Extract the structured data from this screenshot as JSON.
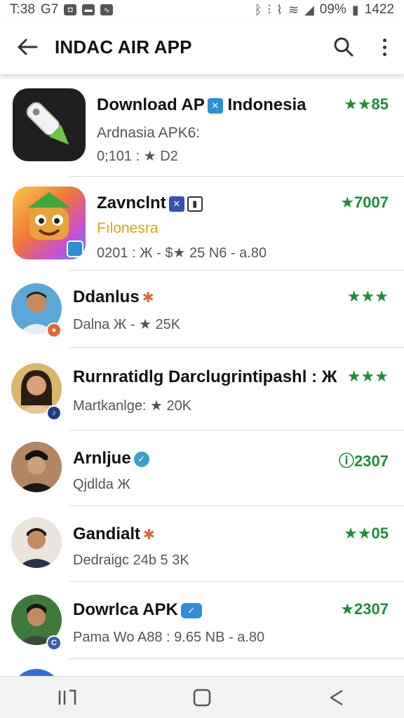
{
  "status_bar": {
    "time": "T:38",
    "carrier": "G7",
    "battery": "09%",
    "clock": "1422"
  },
  "app_bar": {
    "title": "INDAC AIR APP"
  },
  "apps": [
    {
      "name": "Download AP",
      "name_suffix": "Indonesia",
      "sub": "Ardnasia APK6:",
      "meta": "0;101 : ★ D2",
      "rating": "★★85"
    },
    {
      "name": "Zavnclnt",
      "sub": "Fılonesra",
      "sub_color": "#e0a31a",
      "meta": "0201 : Ж - $★ 25 N6 - а.80",
      "rating": "★7007"
    }
  ],
  "people": [
    {
      "name": "Ddanlus",
      "meta": "Dalna Ж      - ★ 25K",
      "rating": "★★★"
    },
    {
      "name": "Rurnratidlg Darclugrintipashl : Ж",
      "meta": "Martkanlge: ★ 20K",
      "rating": "★★★"
    },
    {
      "name": "Arnljue",
      "meta": "Qjdlda Ж",
      "rating": "ⓘ2307"
    },
    {
      "name": "Gandialt",
      "meta": "Dedraigc 24b 5 3K",
      "rating": "★★05"
    },
    {
      "name": "Dowrlca APK",
      "meta": "Pama Wo A88 : 9.65 NB - а.80",
      "rating": "★2307"
    }
  ],
  "nav": {
    "recents": "recents-icon",
    "home": "home-icon",
    "back": "back-icon"
  },
  "colors": {
    "rating_green": "#1e8c3a",
    "accent_orange": "#e0663a",
    "verified_blue": "#3aa0c8"
  }
}
